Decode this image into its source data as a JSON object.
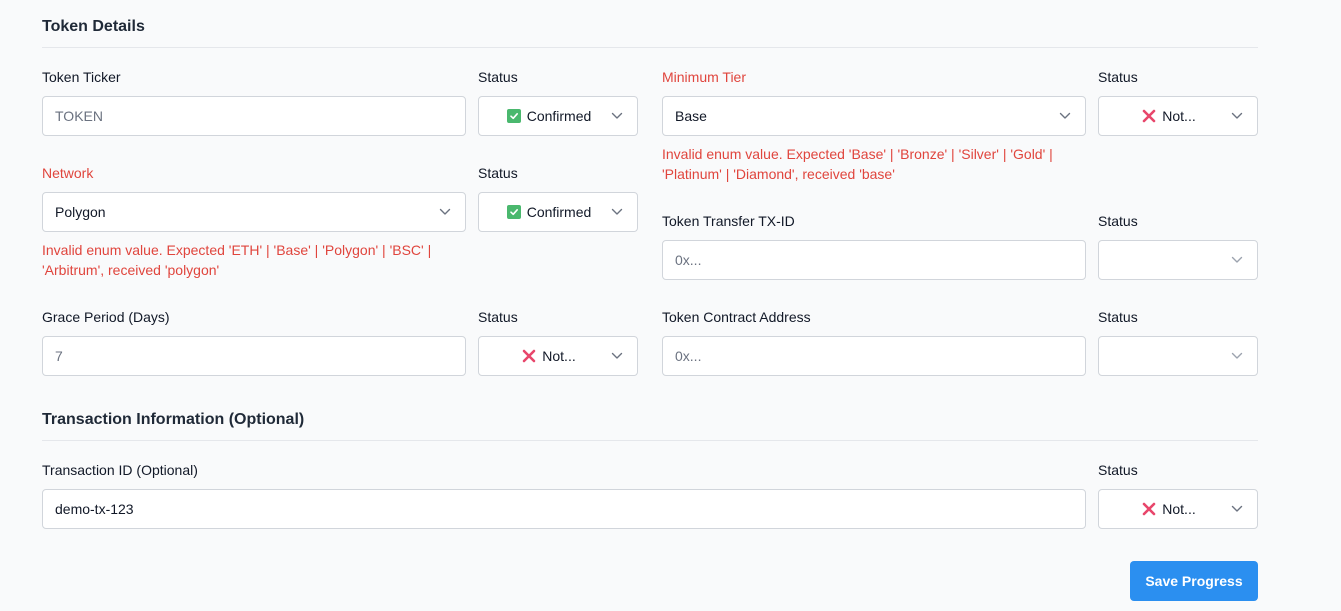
{
  "sections": {
    "token_details": "Token Details",
    "transaction_info": "Transaction Information (Optional)"
  },
  "status_label": "Status",
  "token_ticker": {
    "label": "Token Ticker",
    "placeholder": "TOKEN",
    "status": "Confirmed"
  },
  "network": {
    "label": "Network",
    "value": "Polygon",
    "status": "Confirmed",
    "error_line1": "Invalid enum value. Expected 'ETH' | 'Base' | 'Polygon' | 'BSC' |",
    "error_line2": "'Arbitrum', received 'polygon'"
  },
  "grace_period": {
    "label": "Grace Period (Days)",
    "placeholder": "7",
    "status": "Not..."
  },
  "minimum_tier": {
    "label": "Minimum Tier",
    "value": "Base",
    "status": "Not...",
    "error_line1": "Invalid enum value. Expected 'Base' | 'Bronze' | 'Silver' | 'Gold' |",
    "error_line2": "'Platinum' | 'Diamond', received 'base'"
  },
  "token_transfer_txid": {
    "label": "Token Transfer TX-ID",
    "placeholder": "0x...",
    "status": ""
  },
  "token_contract_address": {
    "label": "Token Contract Address",
    "placeholder": "0x...",
    "status": ""
  },
  "transaction_id": {
    "label": "Transaction ID (Optional)",
    "value": "demo-tx-123",
    "status": "Not..."
  },
  "actions": {
    "save_label": "Save Progress"
  },
  "colors": {
    "error": "#e0453d",
    "confirmed": "#4ab86e",
    "not_confirmed": "#e8466b",
    "primary_button": "#2b8ff0"
  }
}
